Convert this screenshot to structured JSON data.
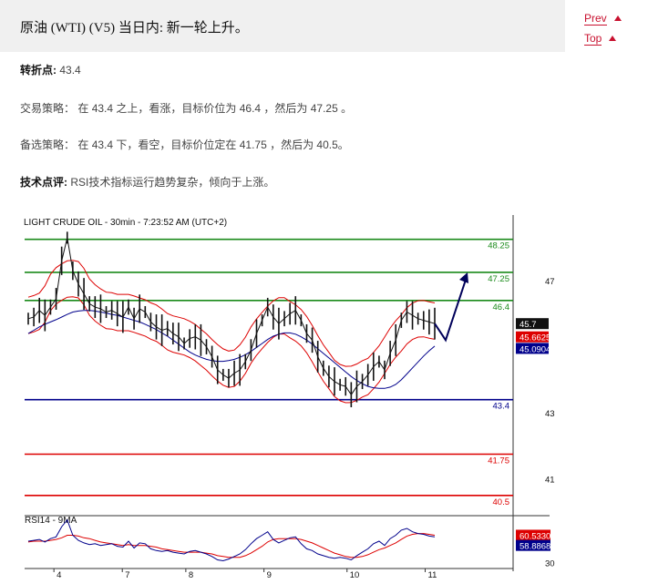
{
  "header": {
    "title": "原油 (WTI) (V5) 当日内: 新一轮上升。",
    "prev_label": "Prev",
    "top_label": "Top"
  },
  "pivot": {
    "label": "转折点:",
    "value": "43.4"
  },
  "strategy": {
    "label": "交易策略：",
    "text": "在 43.4 之上，看涨，目标价位为 46.4 ，然后为 47.25 。"
  },
  "alternative": {
    "label": "备选策略：",
    "text": "在 43.4 下，看空，目标价位定在 41.75 ，然后为 40.5。"
  },
  "comment": {
    "label": "技术点评:",
    "text": "RSI技术指标运行趋势复杂，倾向于上涨。"
  },
  "colors": {
    "resistance": "#1a8a1a",
    "pivot": "#00008b",
    "support": "#dd0000",
    "price": "#111111",
    "ma_blue": "#00008b",
    "bollinger": "#dd0000",
    "arrow": "#00005a"
  },
  "chart_data": [
    {
      "type": "line",
      "title": "LIGHT CRUDE OIL - 30min - 7:23:52 AM (UTC+2)",
      "x_ticks": [
        "4",
        "7",
        "8",
        "9",
        "10",
        "11"
      ],
      "y_ticks": [
        47,
        43,
        41
      ],
      "ylim": [
        40.0,
        48.6
      ],
      "levels": [
        {
          "value": 48.25,
          "label": "48.25",
          "kind": "resistance"
        },
        {
          "value": 47.25,
          "label": "47.25",
          "kind": "resistance"
        },
        {
          "value": 46.4,
          "label": "46.4",
          "kind": "resistance"
        },
        {
          "value": 43.4,
          "label": "43.4",
          "kind": "pivot"
        },
        {
          "value": 41.75,
          "label": "41.75",
          "kind": "support"
        },
        {
          "value": 40.5,
          "label": "40.5",
          "kind": "support"
        }
      ],
      "badges": [
        {
          "value": 45.7,
          "label": "45.7",
          "color": "#111111"
        },
        {
          "value": 45.3,
          "label": "45.6625",
          "color": "#dd0000"
        },
        {
          "value": 44.95,
          "label": "45.0904",
          "color": "#00008b"
        }
      ],
      "series": [
        {
          "name": "price",
          "values": [
            45.85,
            45.9,
            46.1,
            45.95,
            46.2,
            46.45,
            47.6,
            48.3,
            47.3,
            46.9,
            46.6,
            46.3,
            46.2,
            46.15,
            46.05,
            46.1,
            46.0,
            45.9,
            46.2,
            45.85,
            46.15,
            46.05,
            45.75,
            45.6,
            45.5,
            45.55,
            45.4,
            45.3,
            45.1,
            45.25,
            45.3,
            45.2,
            45.0,
            44.7,
            44.3,
            44.15,
            44.05,
            44.2,
            44.3,
            44.55,
            44.9,
            45.4,
            45.8,
            46.2,
            45.9,
            45.7,
            45.85,
            46.0,
            46.1,
            45.8,
            45.4,
            45.2,
            44.7,
            44.35,
            44.1,
            43.95,
            43.85,
            43.8,
            43.55,
            43.8,
            43.95,
            44.15,
            44.4,
            44.55,
            44.3,
            44.8,
            45.2,
            45.8,
            46.05,
            45.95,
            45.85,
            45.8,
            45.75,
            45.7
          ]
        },
        {
          "name": "ma",
          "values": [
            45.4,
            45.5,
            45.6,
            45.68,
            45.75,
            45.82,
            45.9,
            45.98,
            46.05,
            46.08,
            46.1,
            46.1,
            46.08,
            46.05,
            46.02,
            45.98,
            45.95,
            45.9,
            45.85,
            45.8,
            45.75,
            45.68,
            45.6,
            45.52,
            45.42,
            45.32,
            45.2,
            45.08,
            44.96,
            44.84,
            44.75,
            44.68,
            44.62,
            44.58,
            44.56,
            44.56,
            44.58,
            44.62,
            44.68,
            44.76,
            44.86,
            44.98,
            45.1,
            45.22,
            45.32,
            45.38,
            45.42,
            45.42,
            45.38,
            45.3,
            45.2,
            45.08,
            44.94,
            44.8,
            44.66,
            44.52,
            44.38,
            44.24,
            44.1,
            43.98,
            43.88,
            43.8,
            43.76,
            43.74,
            43.74,
            43.78,
            43.86,
            44.0,
            44.18,
            44.36,
            44.54,
            44.72,
            44.88,
            45.02
          ]
        }
      ],
      "forecast": [
        45.7,
        45.2,
        47.25
      ]
    },
    {
      "type": "line",
      "title": "RSI14 - 9MA",
      "x_ticks": [
        "4",
        "7",
        "8",
        "9",
        "10",
        "11"
      ],
      "y_ticks": [
        30
      ],
      "ylim": [
        25,
        85
      ],
      "badges": [
        {
          "value": 62,
          "label": "60.5330",
          "color": "#dd0000"
        },
        {
          "value": 50,
          "label": "58.8868",
          "color": "#00008b"
        }
      ],
      "series": [
        {
          "name": "rsi",
          "values": [
            55,
            56,
            57,
            54,
            58,
            60,
            72,
            80,
            62,
            56,
            53,
            51,
            52,
            50,
            51,
            52,
            49,
            48,
            55,
            47,
            53,
            52,
            46,
            44,
            43,
            44,
            42,
            41,
            40,
            43,
            44,
            42,
            40,
            37,
            33,
            32,
            34,
            37,
            40,
            45,
            52,
            58,
            62,
            66,
            57,
            53,
            56,
            59,
            60,
            52,
            46,
            44,
            40,
            38,
            36,
            35,
            36,
            35,
            33,
            38,
            42,
            46,
            52,
            55,
            50,
            58,
            62,
            68,
            70,
            66,
            64,
            63,
            61,
            60
          ]
        },
        {
          "name": "rsi_ma",
          "values": [
            54,
            55,
            55,
            55,
            56,
            57,
            59,
            62,
            62,
            61,
            59,
            58,
            56,
            54,
            53,
            52,
            51,
            50,
            51,
            50,
            50,
            50,
            49,
            48,
            46,
            45,
            44,
            43,
            42,
            42,
            42,
            42,
            41,
            40,
            38,
            37,
            36,
            36,
            36,
            38,
            41,
            45,
            49,
            54,
            57,
            58,
            58,
            58,
            58,
            57,
            55,
            53,
            50,
            47,
            44,
            41,
            39,
            37,
            36,
            36,
            37,
            39,
            42,
            45,
            47,
            50,
            53,
            57,
            61,
            63,
            64,
            64,
            63,
            62
          ]
        }
      ]
    }
  ]
}
